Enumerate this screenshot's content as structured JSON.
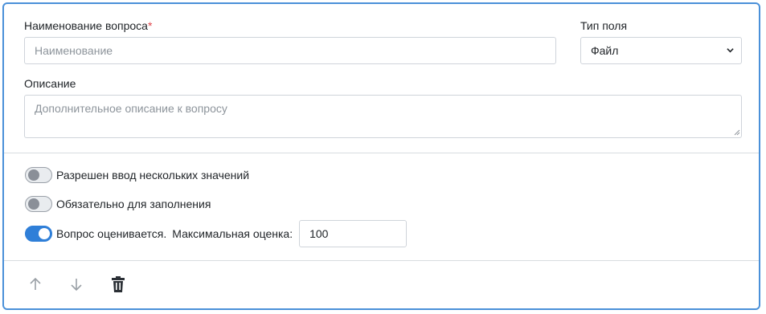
{
  "question": {
    "name_label": "Наименование вопроса",
    "required_mark": "*",
    "name_placeholder": "Наименование",
    "name_value": "",
    "field_type_label": "Тип поля",
    "field_type_value": "Файл",
    "description_label": "Описание",
    "description_placeholder": "Дополнительное описание к вопросу",
    "description_value": ""
  },
  "options": {
    "multiple_values": {
      "label": "Разрешен ввод нескольких значений",
      "enabled": false
    },
    "required": {
      "label": "Обязательно для заполнения",
      "enabled": false
    },
    "scored": {
      "label": "Вопрос оценивается.",
      "enabled": true,
      "max_score_label": "Максимальная оценка:",
      "max_score_value": "100"
    }
  },
  "actions": {
    "move_up_icon": "arrow-up",
    "move_down_icon": "arrow-down",
    "delete_icon": "trash"
  },
  "colors": {
    "accent": "#2f7fd8",
    "border_focus": "#4a90d9",
    "required": "#e0474c"
  }
}
